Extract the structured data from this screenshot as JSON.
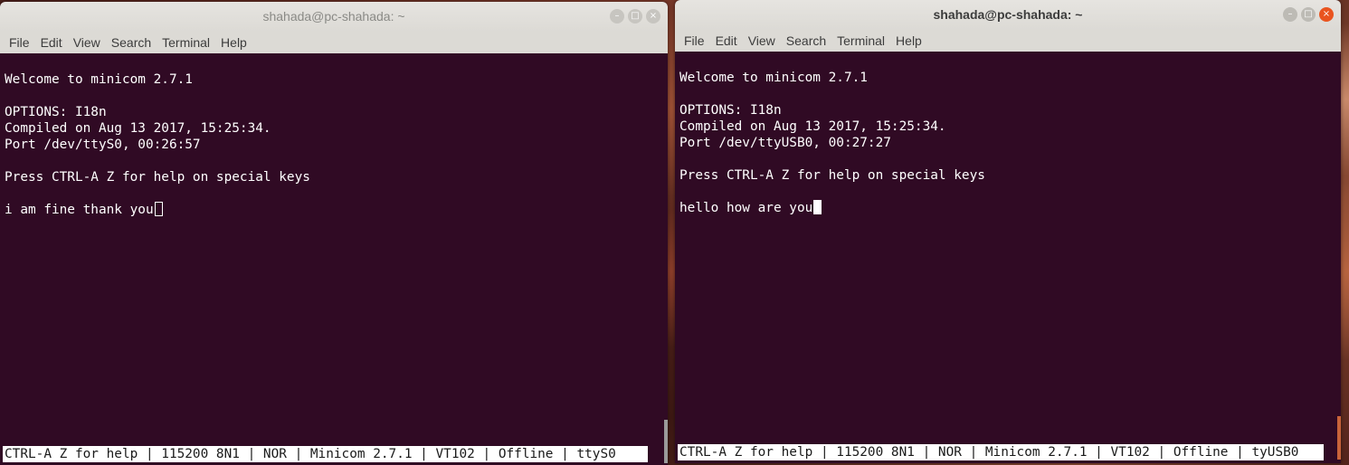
{
  "windows": {
    "left": {
      "title": "shahada@pc-shahada: ~",
      "menu": [
        "File",
        "Edit",
        "View",
        "Search",
        "Terminal",
        "Help"
      ],
      "lines": [
        "Welcome to minicom 2.7.1",
        "",
        "OPTIONS: I18n",
        "Compiled on Aug 13 2017, 15:25:34.",
        "Port /dev/ttyS0, 00:26:57",
        "",
        "Press CTRL-A Z for help on special keys",
        "",
        "i am fine thank you"
      ],
      "status": "CTRL-A Z for help | 115200 8N1 | NOR | Minicom 2.7.1 | VT102 | Offline | ttyS0"
    },
    "right": {
      "title": "shahada@pc-shahada: ~",
      "menu": [
        "File",
        "Edit",
        "View",
        "Search",
        "Terminal",
        "Help"
      ],
      "lines": [
        "Welcome to minicom 2.7.1",
        "",
        "OPTIONS: I18n",
        "Compiled on Aug 13 2017, 15:25:34.",
        "Port /dev/ttyUSB0, 00:27:27",
        "",
        "Press CTRL-A Z for help on special keys",
        "",
        "hello how are you"
      ],
      "status": "CTRL-A Z for help | 115200 8N1 | NOR | Minicom 2.7.1 | VT102 | Offline | tyUSB0"
    }
  },
  "window_buttons": {
    "minimize": "–",
    "maximize": "□",
    "close": "×"
  },
  "colors": {
    "terminal_bg": "#300a24",
    "close_active": "#e9541f"
  }
}
